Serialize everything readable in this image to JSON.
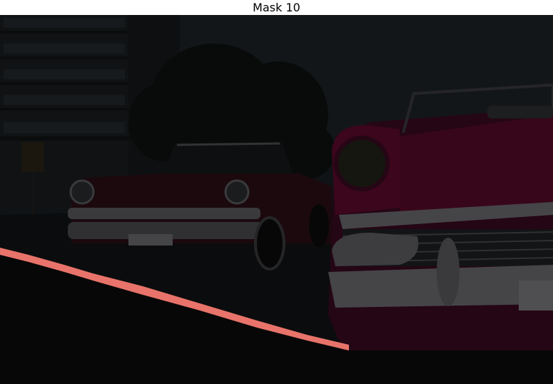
{
  "title": "Mask 10",
  "colors": {
    "background_dark": "#16191c",
    "sky": "#1d2226",
    "road": "#0d0e0f",
    "mask": "#e8736a",
    "car_red": "#5c0a2c",
    "chrome": "#6b6b6e"
  },
  "icons": {
    "image": "photo-of-vintage-cars-with-mask-overlay"
  }
}
